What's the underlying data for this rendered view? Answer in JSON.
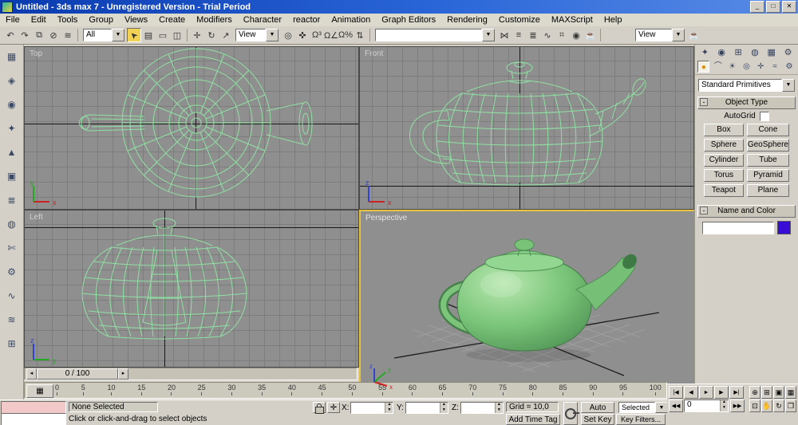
{
  "window": {
    "title": "Untitled - 3ds max 7  - Unregistered Version - Trial Period",
    "min": "_",
    "max": "□",
    "close": "✕"
  },
  "menu": {
    "items": [
      "File",
      "Edit",
      "Tools",
      "Group",
      "Views",
      "Create",
      "Modifiers",
      "Character",
      "reactor",
      "Animation",
      "Graph Editors",
      "Rendering",
      "Customize",
      "MAXScript",
      "Help"
    ]
  },
  "icons": {
    "dropdown_arrow": "▼",
    "spin_up": "▲",
    "spin_dn": "▼"
  },
  "toolbar": {
    "icons_1": [
      "↶",
      "↷",
      "⧉",
      "⊘",
      "≋"
    ],
    "filter_value": "All",
    "select_arrow": "➤",
    "icons_2": [
      "▤",
      "▭",
      "◫"
    ],
    "move": "✛",
    "rotate": "↻",
    "scale": "↗",
    "coord_value": "View",
    "icons_3": [
      "◎",
      "✜",
      "Ω³",
      "Ω∠",
      "Ω%",
      "⇅"
    ],
    "named_sets_value": "",
    "icons_4": [
      "⋈",
      "≡",
      "≣",
      "∿",
      "⌗",
      "◉",
      "☕"
    ],
    "render_value": "View",
    "quick_render": "☕"
  },
  "left_toolbar": {
    "icons": [
      "▦",
      "◈",
      "◉",
      "✦",
      "▲",
      "▣",
      "≣",
      "◍",
      "✄",
      "⚙",
      "∿",
      "≋",
      "⊞"
    ]
  },
  "viewports": {
    "top": "Top",
    "front": "Front",
    "left": "Left",
    "perspective": "Perspective"
  },
  "axis": {
    "x": "x",
    "y": "y",
    "z": "z"
  },
  "timeline": {
    "slider": "0 / 100",
    "left_arrow": "◂",
    "right_arrow": "▸",
    "ruler_icon": "▦",
    "ticks": [
      "0",
      "5",
      "10",
      "15",
      "20",
      "25",
      "30",
      "35",
      "40",
      "45",
      "50",
      "55",
      "60",
      "65",
      "70",
      "75",
      "80",
      "85",
      "90",
      "95",
      "100"
    ]
  },
  "command_panel": {
    "tabs": [
      "✦",
      "◉",
      "⊞",
      "◍",
      "▦",
      "⚙"
    ],
    "categories": [
      "●",
      "⌒",
      "☀",
      "◎",
      "✛",
      "≈",
      "⚙"
    ],
    "dropdown": "Standard Primitives",
    "minus": "-",
    "rollouts": {
      "object_type": "Object Type",
      "name_color": "Name and Color"
    },
    "autogrid": "AutoGrid",
    "object_buttons": [
      "Box",
      "Cone",
      "Sphere",
      "GeoSphere",
      "Cylinder",
      "Tube",
      "Torus",
      "Pyramid",
      "Teapot",
      "Plane"
    ],
    "color_swatch": "#3a0cd8"
  },
  "status": {
    "none_selected": "None Selected",
    "prompt": "Click or click-and-drag to select objects",
    "x": "X:",
    "y": "Y:",
    "z": "Z:",
    "grid": "Grid = 10,0",
    "add_time_tag": "Add Time Tag",
    "auto_key": "Auto Key",
    "set_key": "Set Key",
    "key_mode": "Selected",
    "key_filters": "Key Filters...",
    "time_value": "0"
  },
  "playback": {
    "buttons": [
      "|◀",
      "◀",
      "►",
      "▶",
      "▶|"
    ],
    "prev_key": "◀◀",
    "next_key": "▶▶"
  },
  "nav": {
    "icons": [
      "⊕",
      "⊞",
      "▣",
      "▦",
      "⊡",
      "✋",
      "↻",
      "❒"
    ]
  },
  "colors": {
    "wireframe": "#8fe0a2",
    "active_viewport_border": "#e8c43c",
    "teapot": "#7cc47c",
    "viewport_bg": "#8f8f8f"
  }
}
